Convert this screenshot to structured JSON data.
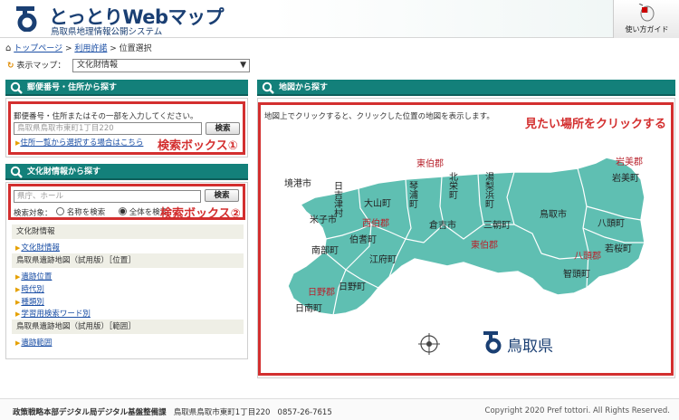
{
  "header": {
    "title": "とっとりWebマップ",
    "subtitle": "鳥取県地理情報公開システム",
    "guide_label": "使い方ガイド"
  },
  "breadcrumb": {
    "top": "トップページ",
    "terms": "利用許諾",
    "sep1": ">",
    "sep2": ">",
    "current": "位置選択"
  },
  "map_select": {
    "label": "表示マップ：",
    "value": "文化財情報"
  },
  "postal_panel": {
    "title": "郵便番号・住所から探す",
    "instruction": "郵便番号・住所またはその一部を入力してください。",
    "placeholder": "鳥取県鳥取市東町1丁目220",
    "search_label": "検索",
    "list_link": "住所一覧から選択する場合はこちら",
    "annotation": "検索ボックス①"
  },
  "cultural_panel": {
    "title": "文化財情報から探す",
    "placeholder": "県庁、ホール",
    "search_label": "検索",
    "target_label": "検索対象：",
    "radio_name": "名称を検索",
    "radio_all": "全体を検索",
    "annotation": "検索ボックス②"
  },
  "layer_list": {
    "groups": [
      {
        "title": "文化財情報",
        "items": [
          "文化財情報"
        ]
      },
      {
        "title": "鳥取県遺跡地図（試用版）［位置］",
        "items": [
          "遺跡位置",
          "時代別",
          "種類別",
          "学習用検索ワード別"
        ]
      },
      {
        "title": "鳥取県遺跡地図（試用版）［範囲］",
        "items": [
          "遺跡範囲"
        ]
      }
    ]
  },
  "map_panel": {
    "title": "地図から探す",
    "instruction": "地図上でクリックすると、クリックした位置の地図を表示します。",
    "annotation": "見たい場所をクリックする",
    "pref_name": "鳥取県",
    "labels": {
      "sakaiminato": "境港市",
      "hiezu": "日吉津村",
      "yonago": "米子市",
      "daisen": "大山町",
      "saihaku": "西伯郡",
      "hoki": "伯耆町",
      "nanbu": "南部町",
      "kofu": "江府町",
      "hino_gun": "日野郡",
      "hino": "日野町",
      "nichinan": "日南町",
      "tohaku": "東伯郡",
      "kotoura": "琴浦町",
      "hokuei": "北栄町",
      "yurihama": "湯梨浜町",
      "kurayoshi": "倉吉市",
      "misasa": "三朝町",
      "tohaku2": "東伯郡",
      "tottori": "鳥取市",
      "iwami_gun": "岩美郡",
      "iwami": "岩美町",
      "yazu": "八頭町",
      "wakasa": "若桜町",
      "yazu_gun": "八頭郡",
      "chizu": "智頭町"
    }
  },
  "footer": {
    "org": "政策戦略本部デジタル局デジタル基盤整備課",
    "address": "鳥取県鳥取市東町1丁目220",
    "phone": "0857-26-7615",
    "copyright": "Copyright 2020 Pref tottori. All Rights Reserved."
  },
  "colors": {
    "teal": "#13807a",
    "map_fill": "#5fbfb2",
    "annotation_red": "#d32f2f",
    "link_blue": "#1b4fa5"
  }
}
